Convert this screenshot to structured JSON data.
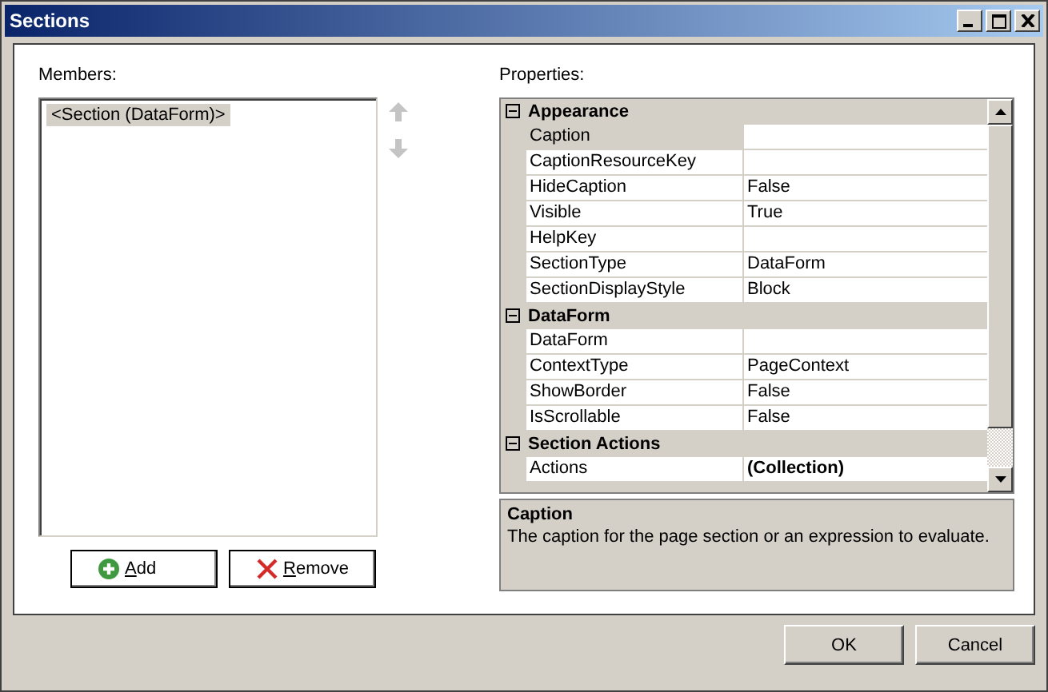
{
  "window": {
    "title": "Sections"
  },
  "members": {
    "label": "Members:",
    "items": [
      {
        "text": "<Section (DataForm)>",
        "selected": true
      }
    ],
    "move_up": {
      "disabled": true
    },
    "move_down": {
      "disabled": true
    }
  },
  "member_buttons": [
    {
      "kind": "add",
      "label": "Add"
    },
    {
      "kind": "remove",
      "label": "Remove"
    }
  ],
  "properties": {
    "label": "Properties:",
    "categories": [
      {
        "name": "Appearance",
        "expanded": true,
        "rows": [
          {
            "name": "Caption",
            "selected": true,
            "modified": false
          },
          {
            "name": "CaptionResourceKey",
            "selected": false,
            "modified": false
          },
          {
            "name": "HideCaption",
            "value": "False",
            "selected": false,
            "modified": false
          },
          {
            "name": "Visible",
            "value": "True",
            "selected": false,
            "modified": false
          },
          {
            "name": "HelpKey",
            "selected": false,
            "modified": false
          },
          {
            "name": "SectionType",
            "value": "DataForm",
            "selected": false,
            "modified": false
          },
          {
            "name": "SectionDisplayStyle",
            "value": "Block",
            "selected": false,
            "modified": false
          }
        ]
      },
      {
        "name": "DataForm",
        "expanded": true,
        "rows": [
          {
            "name": "DataForm",
            "selected": false,
            "modified": false
          },
          {
            "name": "ContextType",
            "value": "PageContext",
            "selected": false,
            "modified": false
          },
          {
            "name": "ShowBorder",
            "value": "False",
            "selected": false,
            "modified": false
          },
          {
            "name": "IsScrollable",
            "value": "False",
            "selected": false,
            "modified": false
          }
        ]
      },
      {
        "name": "Section Actions",
        "expanded": true,
        "rows": [
          {
            "name": "Actions",
            "value": "(Collection)",
            "selected": false,
            "modified": true
          }
        ]
      }
    ]
  },
  "description": {
    "title": "Caption",
    "text": "The caption for the page section or an expression to evaluate."
  },
  "buttons": [
    "OK",
    "Cancel"
  ]
}
